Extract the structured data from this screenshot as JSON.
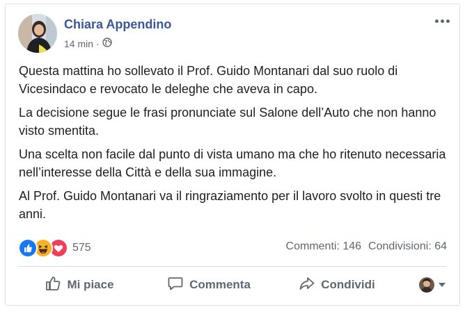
{
  "post": {
    "author": "Chiara Appendino",
    "time": "14 min",
    "privacy_icon": "globe-icon",
    "paragraphs": [
      "Questa mattina ho sollevato il Prof. Guido Montanari dal suo ruolo di Vicesindaco e revocato le deleghe che aveva in capo.",
      "La decisione segue le frasi pronunciate sul Salone dell’Auto che non hanno visto smentita.",
      "Una scelta non facile dal punto di vista umano ma che ho ritenuto necessaria nell’interesse della Città e della sua immagine.",
      "Al Prof. Guido Montanari va il ringraziamento per il lavoro svolto in questi tre anni."
    ]
  },
  "reactions": {
    "count": "575",
    "types": [
      "like",
      "haha",
      "love"
    ]
  },
  "stats": {
    "comments": "Commenti: 146",
    "shares": "Condivisioni: 64"
  },
  "actions": {
    "like": "Mi piace",
    "comment": "Commenta",
    "share": "Condividi"
  },
  "colors": {
    "author": "#385898",
    "secondary": "#606770",
    "like_blue": "#1877f2",
    "haha_yellow": "#f7b125",
    "love_red": "#f33e58"
  }
}
